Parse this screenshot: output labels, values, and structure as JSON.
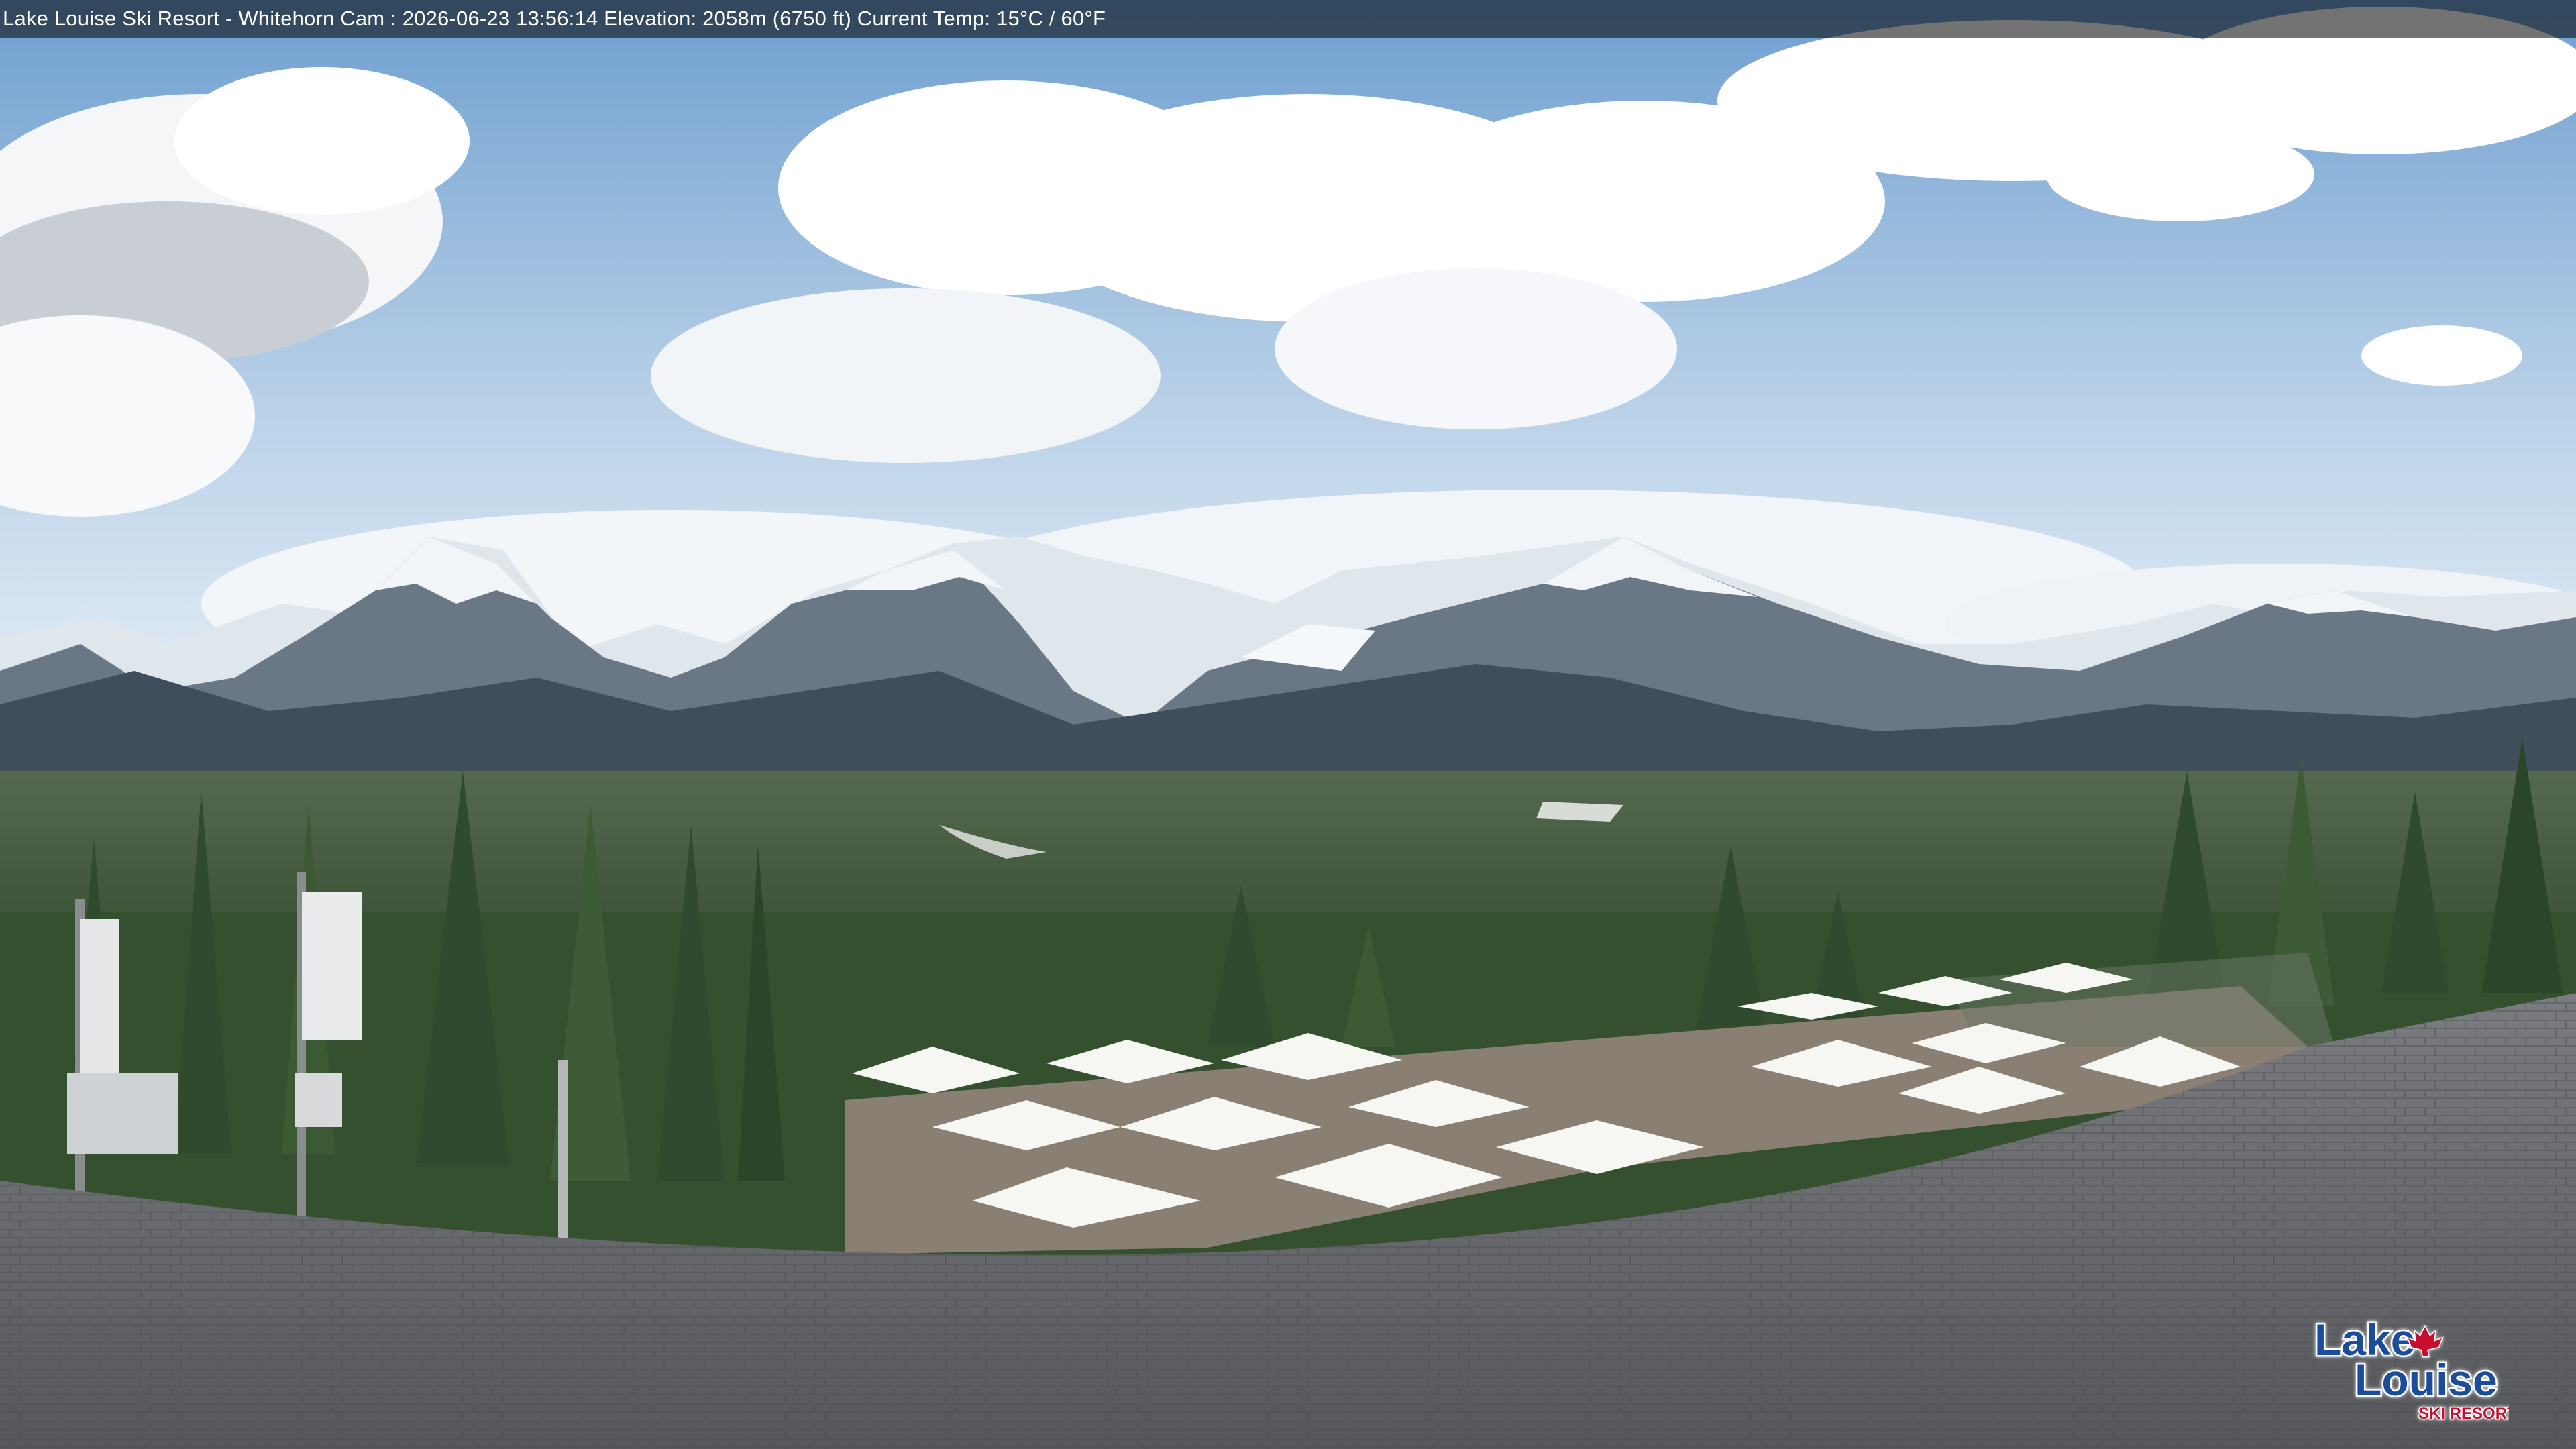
{
  "overlay": {
    "caption": "Lake Louise Ski Resort - Whitehorn Cam : 2026-06-23 13:56:14  Elevation: 2058m (6750 ft) Current Temp: 15°C / 60°F"
  },
  "logo": {
    "line1": "Lake",
    "line2": "Louise",
    "line3": "SKI RESORT",
    "brand_color": "#c8102e"
  },
  "colors": {
    "sky_top": "#6f9fd0",
    "sky_bottom": "#e4eef6",
    "mountain_shadow": "#3e4d5a",
    "snow": "#eef2f5",
    "forest": "#2f4a2c",
    "valley": "#5f7352",
    "deck": "#8a7f73",
    "umbrella": "#f6f6f2",
    "roof": "#6d6f72"
  },
  "scene": {
    "description_icons": [
      "cloud",
      "mountain-range",
      "conifer-forest",
      "antenna",
      "patio-umbrella",
      "shingle-roof"
    ]
  }
}
